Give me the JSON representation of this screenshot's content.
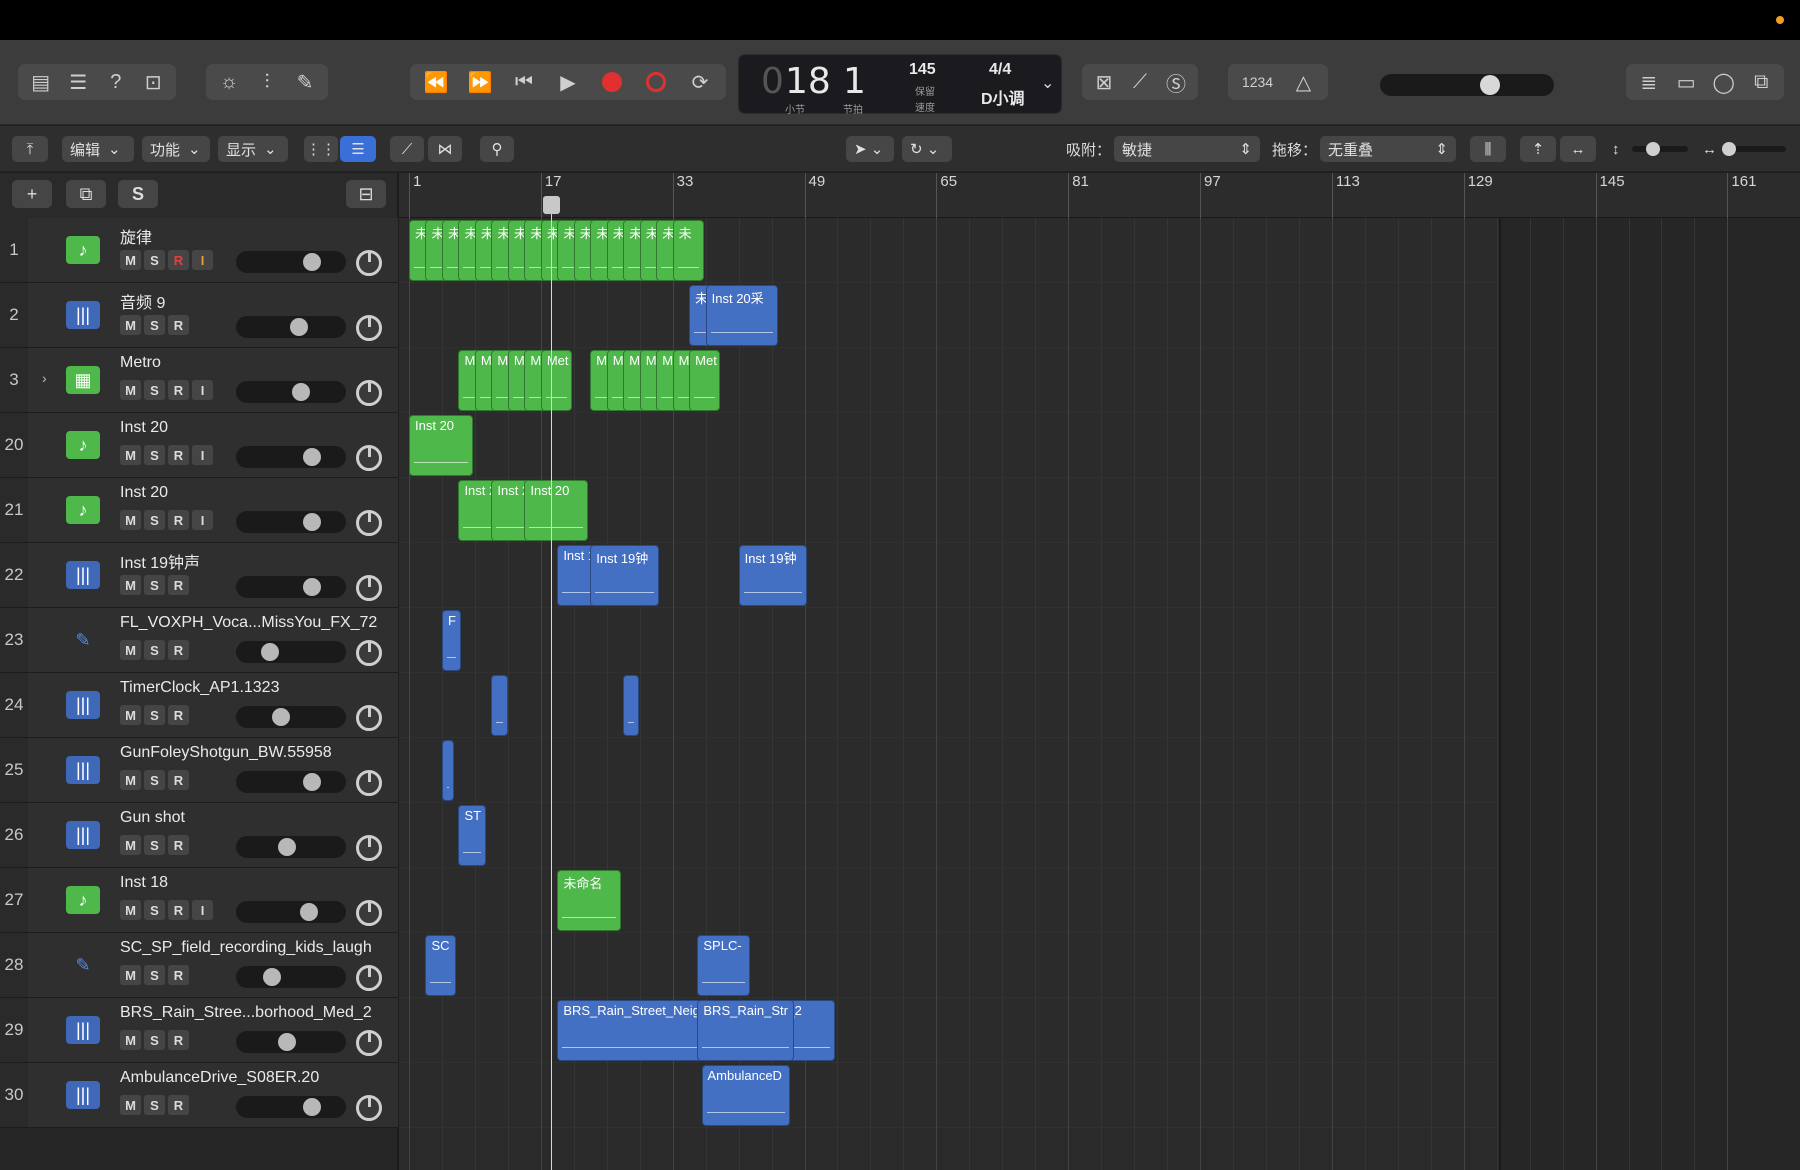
{
  "transport": {
    "bar": "18",
    "beat": "1",
    "bar_label": "小节",
    "beat_label": "节拍",
    "tempo": "145",
    "tempo_label1": "保留",
    "tempo_label2": "速度",
    "time_signature": "4/4",
    "key": "D小调",
    "count_in": "1234"
  },
  "subbar": {
    "edit": "编辑",
    "functions": "功能",
    "view": "显示",
    "snap_label": "吸附：",
    "snap_value": "敏捷",
    "drag_label": "拖移：",
    "drag_value": "无重叠"
  },
  "header": {
    "add": "+",
    "solo": "S"
  },
  "ruler": [
    "1",
    "17",
    "33",
    "49",
    "65",
    "81",
    "97",
    "113",
    "129",
    "145",
    "161"
  ],
  "tracks": [
    {
      "num": "1",
      "name": "旋律",
      "type": "inst",
      "input": true,
      "rec_on": true,
      "fader": 0.75
    },
    {
      "num": "2",
      "name": "音频 9",
      "type": "audio",
      "input": false,
      "fader": 0.6
    },
    {
      "num": "3",
      "name": "Metro",
      "type": "drum",
      "input": true,
      "fader": 0.62
    },
    {
      "num": "20",
      "name": "Inst 20",
      "type": "inst",
      "input": true,
      "fader": 0.75
    },
    {
      "num": "21",
      "name": "Inst 20",
      "type": "inst",
      "input": true,
      "fader": 0.75
    },
    {
      "num": "22",
      "name": "Inst 19钟声",
      "type": "audio",
      "input": false,
      "fader": 0.75
    },
    {
      "num": "23",
      "name": "FL_VOXPH_Voca...MissYou_FX_72",
      "type": "pen",
      "input": false,
      "fader": 0.25
    },
    {
      "num": "24",
      "name": "TimerClock_AP1.1323",
      "type": "audio",
      "input": false,
      "fader": 0.38
    },
    {
      "num": "25",
      "name": "GunFoleyShotgun_BW.55958",
      "type": "audio",
      "input": false,
      "fader": 0.75
    },
    {
      "num": "26",
      "name": "Gun shot",
      "type": "audio",
      "input": false,
      "fader": 0.45
    },
    {
      "num": "27",
      "name": "Inst 18",
      "type": "inst",
      "input": true,
      "fader": 0.72
    },
    {
      "num": "28",
      "name": "SC_SP_field_recording_kids_laugh",
      "type": "pen",
      "input": false,
      "fader": 0.27
    },
    {
      "num": "29",
      "name": "BRS_Rain_Stree...borhood_Med_2",
      "type": "audio",
      "input": false,
      "fader": 0.45
    },
    {
      "num": "30",
      "name": "AmbulanceDrive_S08ER.20",
      "type": "audio",
      "input": false,
      "fader": 0.75
    }
  ],
  "btn_labels": {
    "m": "M",
    "s": "S",
    "r": "R",
    "i": "I"
  },
  "regions": [
    {
      "lane": 0,
      "start": 1,
      "len": 2,
      "label": "未",
      "color": "g"
    },
    {
      "lane": 0,
      "start": 3,
      "len": 2,
      "label": "未",
      "color": "g"
    },
    {
      "lane": 0,
      "start": 5,
      "len": 2,
      "label": "未",
      "color": "g"
    },
    {
      "lane": 0,
      "start": 7,
      "len": 2,
      "label": "未",
      "color": "g"
    },
    {
      "lane": 0,
      "start": 9,
      "len": 2,
      "label": "未",
      "color": "g"
    },
    {
      "lane": 0,
      "start": 11,
      "len": 2,
      "label": "未",
      "color": "g"
    },
    {
      "lane": 0,
      "start": 13,
      "len": 2,
      "label": "未",
      "color": "g"
    },
    {
      "lane": 0,
      "start": 15,
      "len": 2,
      "label": "未",
      "color": "g"
    },
    {
      "lane": 0,
      "start": 17,
      "len": 2,
      "label": "未",
      "color": "g"
    },
    {
      "lane": 0,
      "start": 19,
      "len": 2,
      "label": "未",
      "color": "g"
    },
    {
      "lane": 0,
      "start": 21,
      "len": 2,
      "label": "未",
      "color": "g"
    },
    {
      "lane": 0,
      "start": 23,
      "len": 2,
      "label": "未",
      "color": "g"
    },
    {
      "lane": 0,
      "start": 25,
      "len": 2,
      "label": "未",
      "color": "g"
    },
    {
      "lane": 0,
      "start": 27,
      "len": 2,
      "label": "未",
      "color": "g"
    },
    {
      "lane": 0,
      "start": 29,
      "len": 2,
      "label": "未",
      "color": "g"
    },
    {
      "lane": 0,
      "start": 31,
      "len": 2,
      "label": "未",
      "color": "g"
    },
    {
      "lane": 0,
      "start": 33,
      "len": 2,
      "label": "未",
      "color": "g"
    },
    {
      "lane": 1,
      "start": 35,
      "len": 2,
      "label": "未",
      "color": "b"
    },
    {
      "lane": 1,
      "start": 37,
      "len": 4.5,
      "label": "Inst 20采",
      "color": "b"
    },
    {
      "lane": 2,
      "start": 7,
      "len": 2,
      "label": "Met",
      "color": "g"
    },
    {
      "lane": 2,
      "start": 9,
      "len": 2,
      "label": "Met",
      "color": "g"
    },
    {
      "lane": 2,
      "start": 11,
      "len": 2,
      "label": "Met",
      "color": "g"
    },
    {
      "lane": 2,
      "start": 13,
      "len": 2,
      "label": "Met",
      "color": "g"
    },
    {
      "lane": 2,
      "start": 15,
      "len": 2,
      "label": "Met",
      "color": "g"
    },
    {
      "lane": 2,
      "start": 17,
      "len": 2,
      "label": "Met",
      "color": "g"
    },
    {
      "lane": 2,
      "start": 23,
      "len": 2,
      "label": "Met",
      "color": "g"
    },
    {
      "lane": 2,
      "start": 25,
      "len": 2,
      "label": "Met",
      "color": "g"
    },
    {
      "lane": 2,
      "start": 27,
      "len": 2,
      "label": "Met",
      "color": "g"
    },
    {
      "lane": 2,
      "start": 29,
      "len": 2,
      "label": "Met",
      "color": "g"
    },
    {
      "lane": 2,
      "start": 31,
      "len": 2,
      "label": "Met",
      "color": "g"
    },
    {
      "lane": 2,
      "start": 33,
      "len": 2,
      "label": "Met",
      "color": "g"
    },
    {
      "lane": 2,
      "start": 35,
      "len": 2,
      "label": "Met",
      "color": "g"
    },
    {
      "lane": 3,
      "start": 1,
      "len": 4,
      "label": "Inst 20",
      "color": "g"
    },
    {
      "lane": 4,
      "start": 7,
      "len": 4,
      "label": "Inst 20",
      "color": "g"
    },
    {
      "lane": 4,
      "start": 11,
      "len": 4,
      "label": "Inst 20",
      "color": "g"
    },
    {
      "lane": 4,
      "start": 15,
      "len": 4,
      "label": "Inst 20",
      "color": "g"
    },
    {
      "lane": 5,
      "start": 19,
      "len": 4,
      "label": "Inst 19",
      "color": "b"
    },
    {
      "lane": 5,
      "start": 23,
      "len": 4.3,
      "label": "Inst 19钟",
      "color": "b"
    },
    {
      "lane": 5,
      "start": 41,
      "len": 4.3,
      "label": "Inst 19钟",
      "color": "b"
    },
    {
      "lane": 6,
      "start": 5,
      "len": 1.3,
      "label": "F",
      "color": "b"
    },
    {
      "lane": 7,
      "start": 11,
      "len": 1.1,
      "label": "",
      "color": "b"
    },
    {
      "lane": 7,
      "start": 27,
      "len": 1.1,
      "label": "",
      "color": "b"
    },
    {
      "lane": 8,
      "start": 5,
      "len": 0.6,
      "label": "",
      "color": "b"
    },
    {
      "lane": 9,
      "start": 7,
      "len": 1.8,
      "label": "ST",
      "color": "b"
    },
    {
      "lane": 10,
      "start": 19,
      "len": 4,
      "label": "未命名",
      "color": "g"
    },
    {
      "lane": 11,
      "start": 3,
      "len": 2,
      "label": "SC",
      "color": "b"
    },
    {
      "lane": 11,
      "start": 36,
      "len": 3.3,
      "label": "SPLC-",
      "color": "b"
    },
    {
      "lane": 12,
      "start": 19,
      "len": 17,
      "label": "BRS_Rain_Street_Neighborhood_Med_2",
      "color": "b"
    },
    {
      "lane": 12,
      "start": 36,
      "len": 6,
      "label": "BRS_Rain_Str",
      "color": "b"
    },
    {
      "lane": 13,
      "start": 36.5,
      "len": 5.5,
      "label": "AmbulanceD",
      "color": "b"
    }
  ],
  "colors": {
    "green_region": "#4fb84a",
    "blue_region": "#4470c4",
    "record": "#e03030"
  }
}
